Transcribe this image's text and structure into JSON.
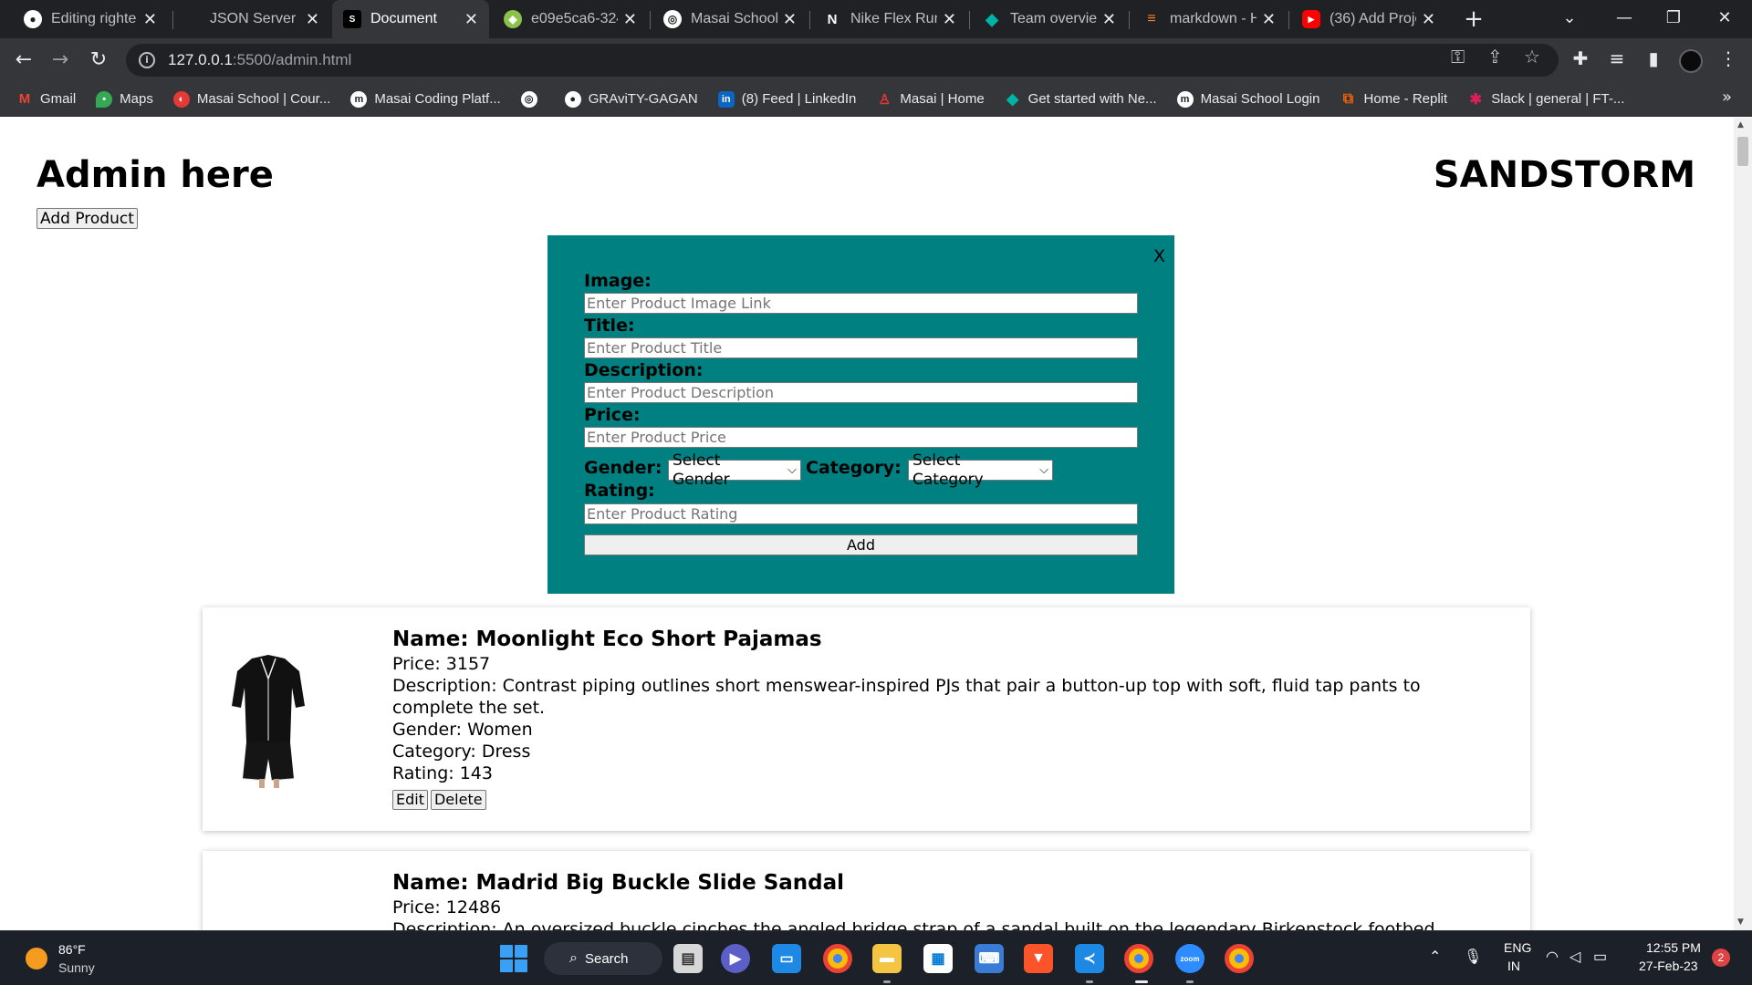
{
  "browser": {
    "tabs": [
      {
        "label": "Editing righte",
        "icon": "github-icon",
        "active": false
      },
      {
        "label": "JSON Server",
        "icon": "none",
        "active": false
      },
      {
        "label": "Document",
        "icon": "document-favicon-icon",
        "active": true
      },
      {
        "label": "e09e5ca6-324",
        "icon": "leaf-icon",
        "active": false
      },
      {
        "label": "Masai School",
        "icon": "globe-icon",
        "active": false
      },
      {
        "label": "Nike Flex Run",
        "icon": "notion-icon",
        "active": false
      },
      {
        "label": "Team overvie",
        "icon": "diamond-icon",
        "active": false
      },
      {
        "label": "markdown - H",
        "icon": "stackoverflow-icon",
        "active": false
      },
      {
        "label": "(36) Add Proje",
        "icon": "youtube-icon",
        "active": false
      }
    ],
    "new_tab_glyph": "+",
    "url_host": "127.0.0.1",
    "url_path": ":5500/admin.html",
    "bookmarks": [
      {
        "label": "Gmail",
        "icon": "gmail-icon",
        "color": "#ea4335"
      },
      {
        "label": "Maps",
        "icon": "maps-icon",
        "color": "#34a853"
      },
      {
        "label": "Masai School | Cour...",
        "icon": "masai-icon",
        "color": "#e53935"
      },
      {
        "label": "Masai Coding Platf...",
        "icon": "masai-m-icon",
        "color": "#ffffff"
      },
      {
        "label": "",
        "icon": "globe-icon",
        "color": "#ffffff"
      },
      {
        "label": "GRAviTY-GAGAN",
        "icon": "github-icon",
        "color": "#ffffff"
      },
      {
        "label": "(8) Feed | LinkedIn",
        "icon": "linkedin-icon",
        "color": "#0a66c2"
      },
      {
        "label": "Masai | Home",
        "icon": "masai-figure-icon",
        "color": "#e53935"
      },
      {
        "label": "Get started with Ne...",
        "icon": "diamond-icon",
        "color": "#00b3a6"
      },
      {
        "label": "Masai School Login",
        "icon": "masai-m-icon",
        "color": "#ffffff"
      },
      {
        "label": "Home - Replit",
        "icon": "replit-icon",
        "color": "#f26207"
      },
      {
        "label": "Slack | general | FT-...",
        "icon": "slack-icon",
        "color": "#e01e5a"
      }
    ],
    "bookmarks_overflow": "»"
  },
  "page": {
    "admin_title": "Admin here",
    "brand": "SANDSTORM",
    "add_product_label": "Add Product",
    "modal": {
      "close_label": "X",
      "image_label": "Image:",
      "image_placeholder": "Enter Product Image Link",
      "title_label": "Title:",
      "title_placeholder": "Enter Product Title",
      "description_label": "Description:",
      "description_placeholder": "Enter Product Description",
      "price_label": "Price:",
      "price_placeholder": "Enter Product Price",
      "gender_label": "Gender:",
      "gender_selected": "Select Gender",
      "category_label": "Category:",
      "category_selected": "Select Category",
      "rating_label": "Rating:",
      "rating_placeholder": "Enter Product Rating",
      "submit_label": "Add"
    },
    "products": [
      {
        "name": "Name: Moonlight Eco Short Pajamas",
        "price": "Price: 3157",
        "description": "Description: Contrast piping outlines short menswear-inspired PJs that pair a button-up top with soft, fluid tap pants to complete the set.",
        "gender": "Gender: Women",
        "category": "Category: Dress",
        "rating": "Rating: 143",
        "edit_label": "Edit",
        "delete_label": "Delete"
      },
      {
        "name": "Name: Madrid Big Buckle Slide Sandal",
        "price": "Price: 12486",
        "description": "Description: An oversized buckle cinches the angled bridge strap of a sandal built on the legendary Birkenstock footbed",
        "gender": "",
        "category": "",
        "rating": "",
        "edit_label": "",
        "delete_label": ""
      }
    ]
  },
  "taskbar": {
    "weather_temp": "86°F",
    "weather_condition": "Sunny",
    "search_label": "Search",
    "apps": [
      "file-explorer-icon",
      "teams-icon",
      "monitor-icon",
      "chrome-icon",
      "folder-icon",
      "store-icon",
      "keyboard-icon",
      "brave-icon",
      "vscode-icon",
      "chrome-icon",
      "zoom-icon",
      "chrome-icon"
    ],
    "zoom_label": "zoom",
    "language_top": "ENG",
    "language_bottom": "IN",
    "time": "12:55 PM",
    "date": "27-Feb-23",
    "notification_count": "2"
  }
}
